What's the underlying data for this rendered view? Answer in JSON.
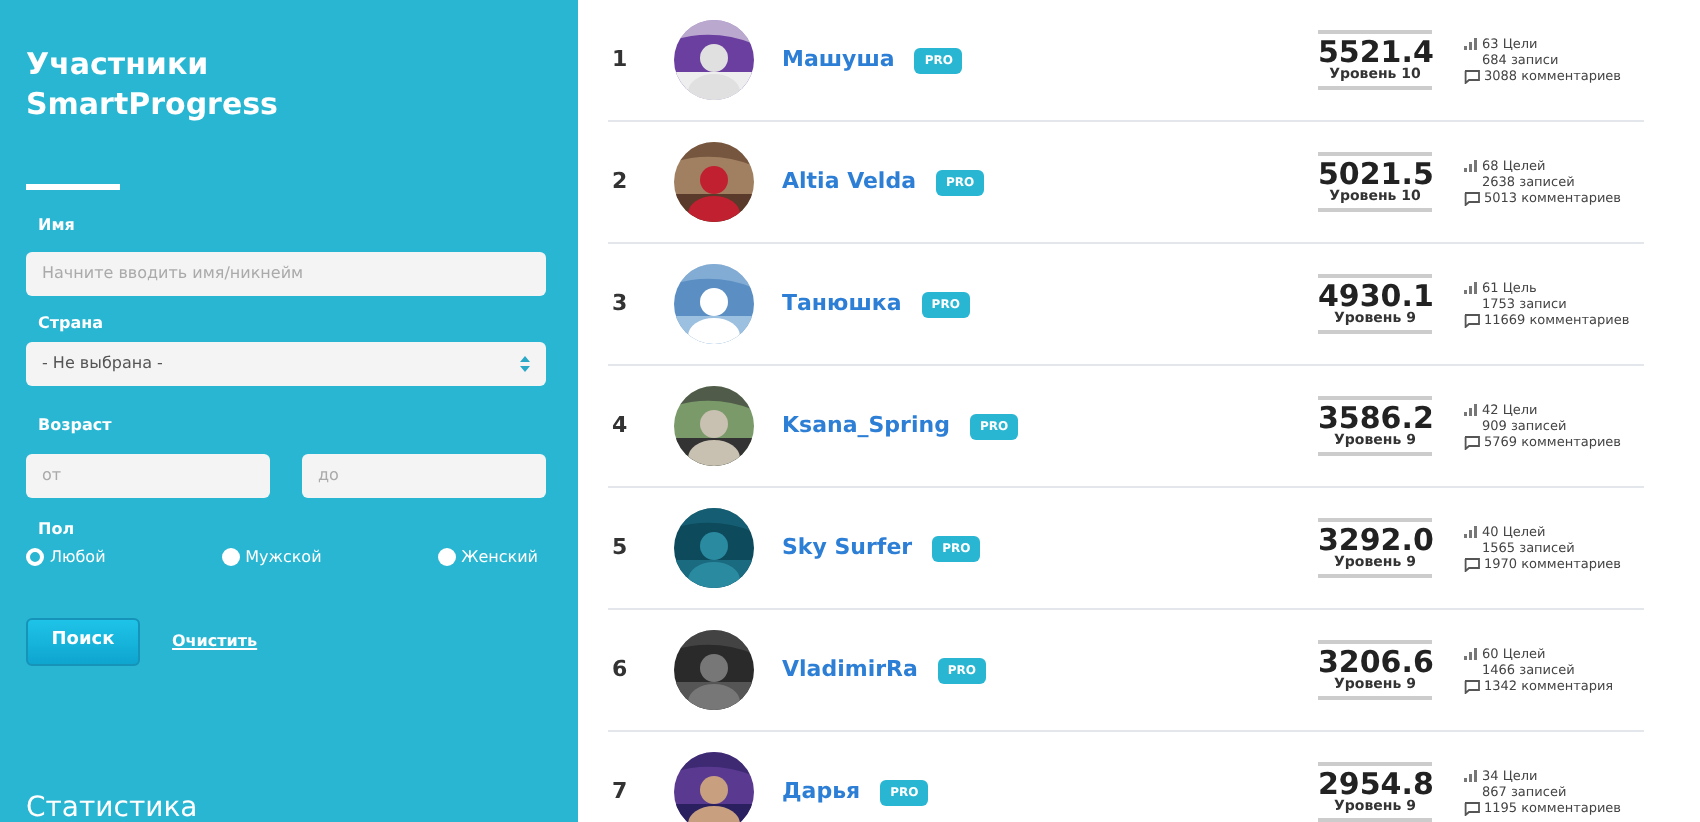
{
  "sidebar": {
    "title": "Участники SmartProgress",
    "filters": {
      "name": {
        "label": "Имя",
        "placeholder": "Начните вводить имя/никнейм"
      },
      "country": {
        "label": "Страна",
        "value": "- Не выбрана -"
      },
      "age": {
        "label": "Возраст",
        "from_placeholder": "от",
        "to_placeholder": "до"
      },
      "gender": {
        "label": "Пол",
        "options": [
          {
            "label": "Любой",
            "selected": true
          },
          {
            "label": "Мужской",
            "selected": false
          },
          {
            "label": "Женский",
            "selected": false
          }
        ]
      },
      "search_button": "Поиск",
      "clear_link": "Очистить"
    },
    "stats_heading": "Статистика"
  },
  "members": [
    {
      "rank": "1",
      "name": "Машуша",
      "badge": "PRO",
      "score": "5521.4",
      "level": "Уровень 10",
      "goals": "63 Цели",
      "posts": "684 записи",
      "comments": "3088 комментариев"
    },
    {
      "rank": "2",
      "name": "Altia Velda",
      "badge": "PRO",
      "score": "5021.5",
      "level": "Уровень 10",
      "goals": "68 Целей",
      "posts": "2638 записей",
      "comments": "5013 комментариев"
    },
    {
      "rank": "3",
      "name": "Танюшка",
      "badge": "PRO",
      "score": "4930.1",
      "level": "Уровень 9",
      "goals": "61 Цель",
      "posts": "1753 записи",
      "comments": "11669 комментариев"
    },
    {
      "rank": "4",
      "name": "Ksana_Spring",
      "badge": "PRO",
      "score": "3586.2",
      "level": "Уровень 9",
      "goals": "42 Цели",
      "posts": "909 записей",
      "comments": "5769 комментариев"
    },
    {
      "rank": "5",
      "name": "Sky Surfer",
      "badge": "PRO",
      "score": "3292.0",
      "level": "Уровень 9",
      "goals": "40 Целей",
      "posts": "1565 записей",
      "comments": "1970 комментариев"
    },
    {
      "rank": "6",
      "name": "VladimirRa",
      "badge": "PRO",
      "score": "3206.6",
      "level": "Уровень 9",
      "goals": "60 Целей",
      "posts": "1466 записей",
      "comments": "1342 комментария"
    },
    {
      "rank": "7",
      "name": "Дарья",
      "badge": "PRO",
      "score": "2954.8",
      "level": "Уровень 9",
      "goals": "34 Цели",
      "posts": "867 записей",
      "comments": "1195 комментариев"
    }
  ]
}
